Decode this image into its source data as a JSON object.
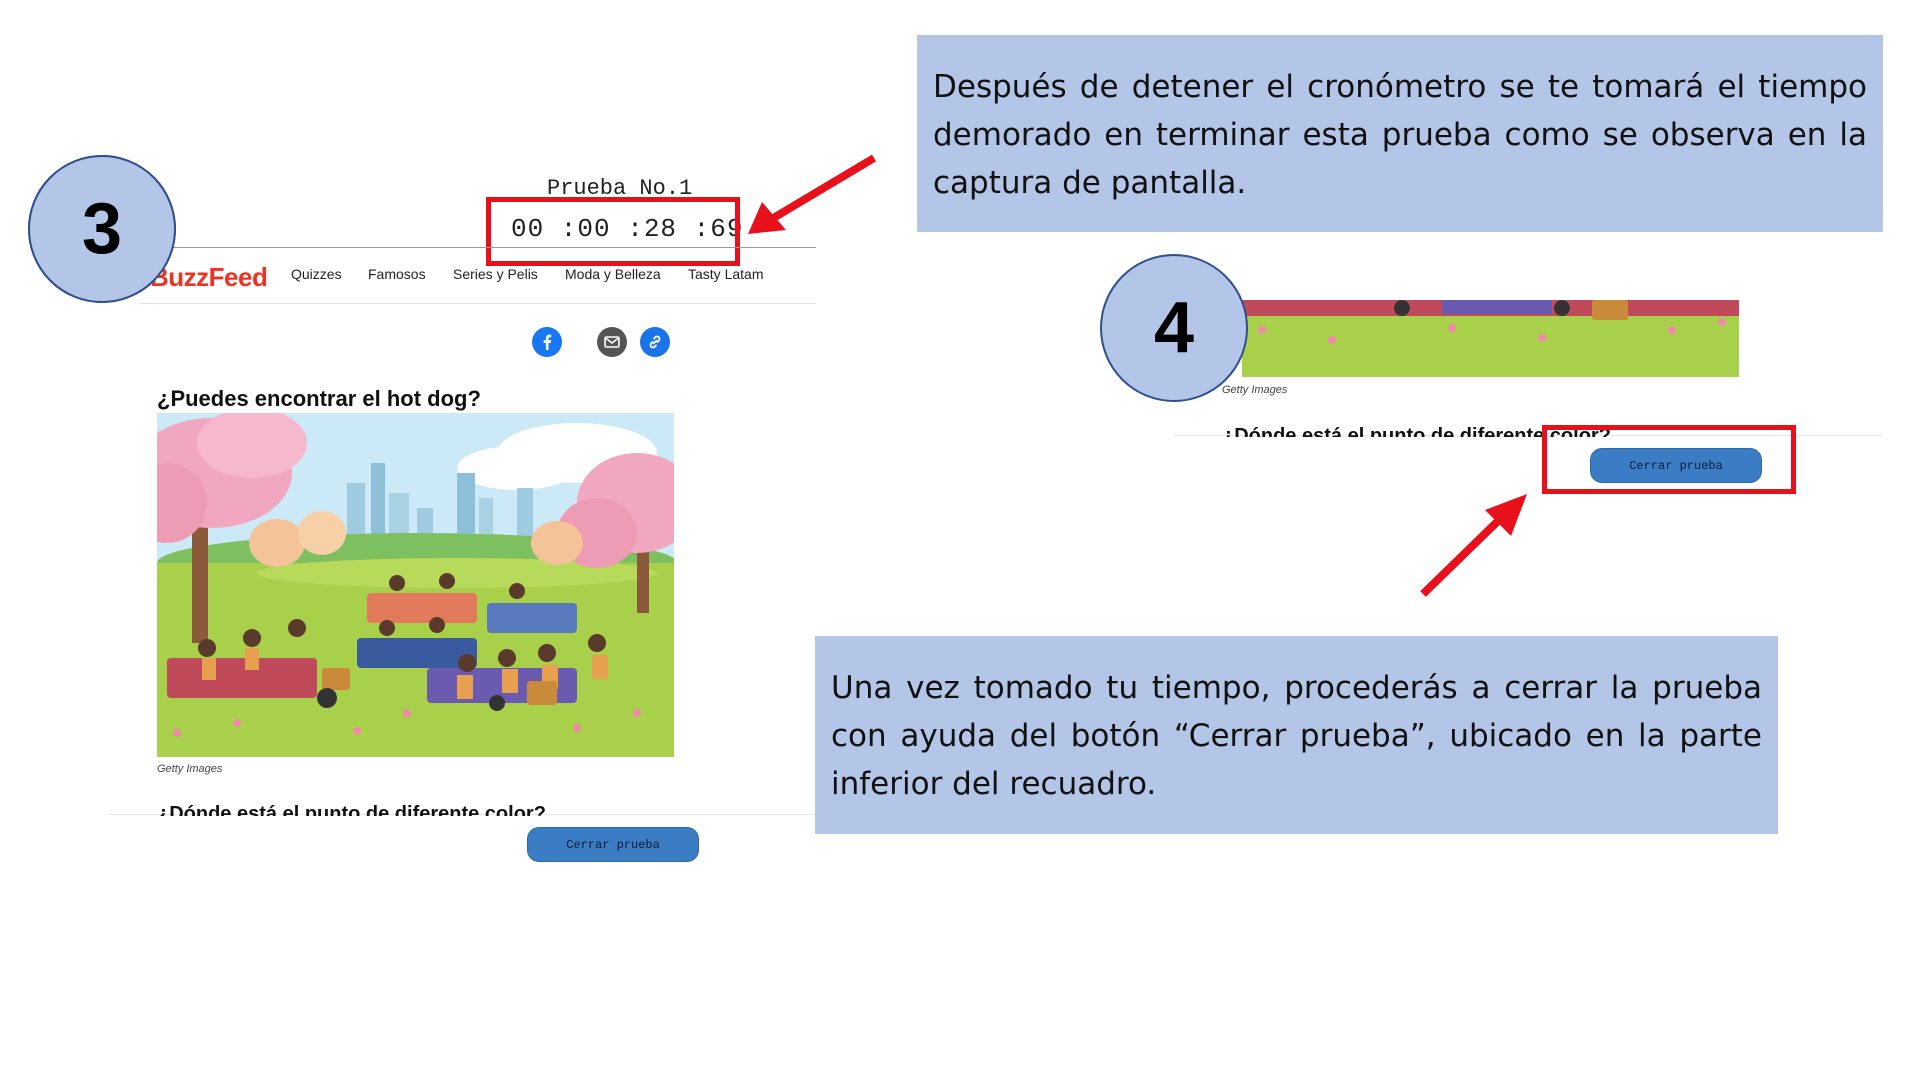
{
  "step3": {
    "number": "3"
  },
  "step4": {
    "number": "4"
  },
  "left_screen": {
    "test_title": "Prueba No.1",
    "timer": "00 :00 :28 :69",
    "brand": "BuzzFeed",
    "nav": [
      "Quizzes",
      "Famosos",
      "Series y Pelis",
      "Moda y Belleza",
      "Tasty Latam"
    ],
    "question1": "¿Puedes encontrar el hot dog?",
    "image_credit": "Getty Images",
    "question2_cut": "¿Dónde está el punto de diferente color?",
    "close_button": "Cerrar prueba"
  },
  "right_screen": {
    "image_credit": "Getty Images",
    "question2_cut": "¿Dónde está el punto de diferente color?",
    "close_button": "Cerrar prueba"
  },
  "callout_top": "Después de detener el cronómetro se te tomará el tiempo demorado en terminar esta prueba como se observa en la captura de pantalla.",
  "callout_bottom": "Una vez tomado tu tiempo, procederás a cerrar la prueba con ayuda del botón “Cerrar prueba”, ubicado en la parte inferior del recuadro.",
  "colors": {
    "callout_bg": "#b4c6e7",
    "highlight": "#e8101a",
    "button": "#3b7dc4",
    "brand": "#ee3322"
  }
}
